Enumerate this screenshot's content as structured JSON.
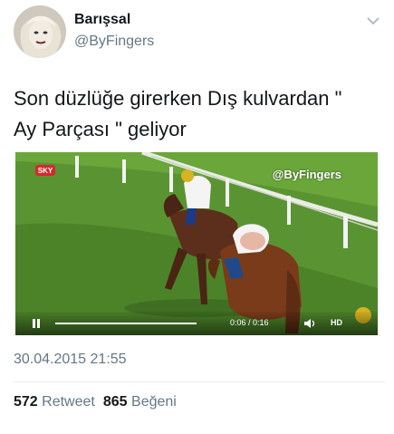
{
  "author": {
    "display_name": "Barışsal",
    "handle": "@ByFingers"
  },
  "tweet": {
    "text_line1": "Son düzlüğe girerken Dış kulvardan \"",
    "text_line2": "Ay Parçası \" geliyor"
  },
  "video": {
    "watermark": "@ByFingers",
    "time": "0:06 / 0:16",
    "hd_label": "HD",
    "progress": 0.375,
    "channel_logo": "sky-logo"
  },
  "timestamp": "30.04.2015 21:55",
  "stats": {
    "retweets": "572",
    "retweets_label": "Retweet",
    "likes": "865",
    "likes_label": "Beğeni"
  },
  "icons": {
    "menu": "chevron-down-icon",
    "play": "pause-icon",
    "volume": "volume-icon"
  }
}
